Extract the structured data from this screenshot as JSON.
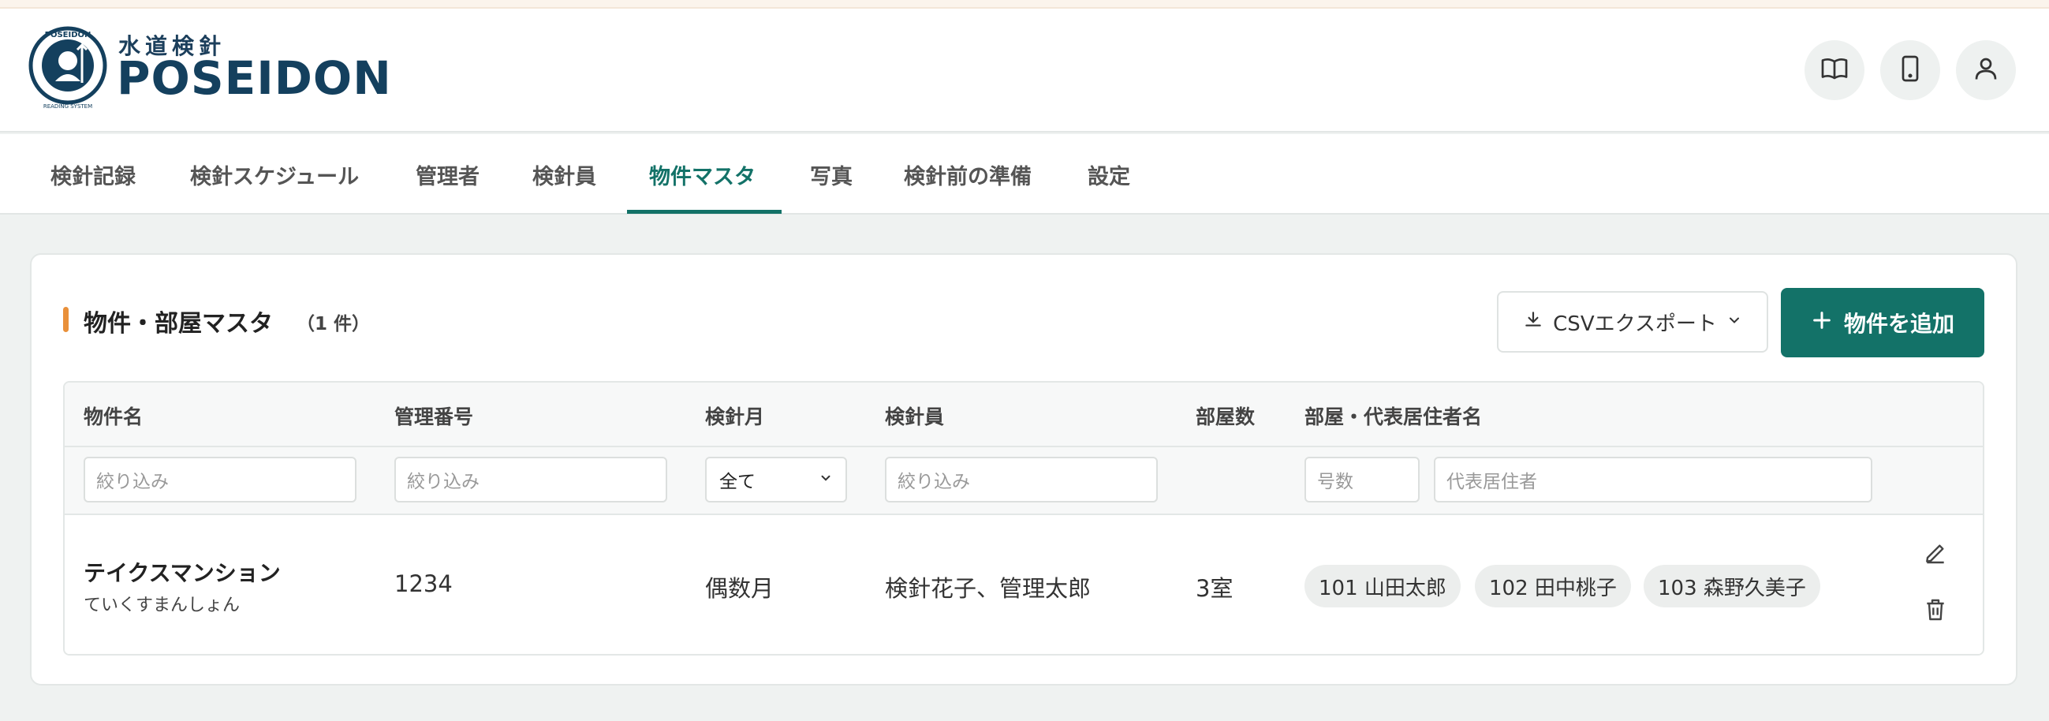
{
  "brand": {
    "subtitle": "水道検針",
    "name": "POSEIDON",
    "logo_text": "POSEIDON"
  },
  "header_icons": [
    "book-icon",
    "phone-icon",
    "user-icon"
  ],
  "nav": {
    "tabs": [
      {
        "label": "検針記録"
      },
      {
        "label": "検針スケジュール"
      },
      {
        "label": "管理者"
      },
      {
        "label": "検針員"
      },
      {
        "label": "物件マスタ",
        "active": true
      },
      {
        "label": "写真"
      },
      {
        "label": "検針前の準備"
      },
      {
        "label": "設定"
      }
    ]
  },
  "page": {
    "title": "物件・部屋マスタ",
    "count": "（1 件）",
    "csv_label": "CSVエクスポート",
    "add_label": "物件を追加"
  },
  "table": {
    "headers": [
      "物件名",
      "管理番号",
      "検針月",
      "検針員",
      "部屋数",
      "部屋・代表居住者名"
    ],
    "filters": {
      "name_placeholder": "絞り込み",
      "code_placeholder": "絞り込み",
      "month_value": "全て",
      "reader_placeholder": "絞り込み",
      "room_no_placeholder": "号数",
      "resident_placeholder": "代表居住者"
    },
    "rows": [
      {
        "name": "テイクスマンション",
        "kana": "ていくすまんしょん",
        "code": "1234",
        "month": "偶数月",
        "readers": "検針花子、管理太郎",
        "rooms_count": "3室",
        "rooms": [
          "101 山田太郎",
          "102 田中桃子",
          "103 森野久美子"
        ]
      }
    ]
  },
  "colors": {
    "accent": "#137268",
    "title_marker": "#e9903a",
    "brand": "#14405e"
  }
}
